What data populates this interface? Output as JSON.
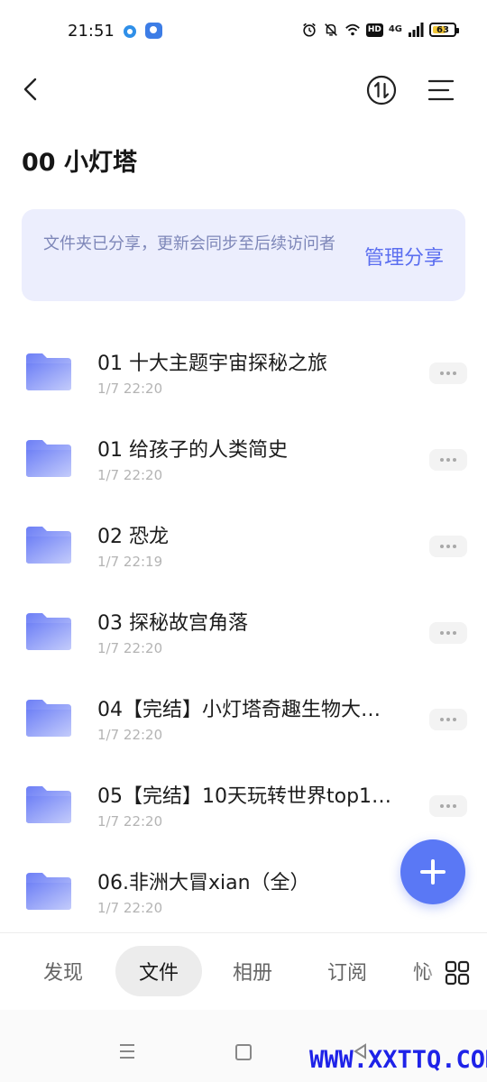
{
  "status_bar": {
    "time": "21:51",
    "network": "4G",
    "hd_label": "HD",
    "battery": "63",
    "battery_level": 0.63,
    "battery_color": "#f2c83a"
  },
  "header": {
    "title": "00 小灯塔"
  },
  "share_banner": {
    "message": "文件夹已分享，更新会同步至后续访问者",
    "manage_label": "管理分享"
  },
  "files": [
    {
      "name": "01 十大主题宇宙探秘之旅",
      "date": "1/7 22:20"
    },
    {
      "name": "01 给孩子的人类简史",
      "date": "1/7 22:20"
    },
    {
      "name": "02 恐龙",
      "date": "1/7 22:19"
    },
    {
      "name": "03 探秘故宫角落",
      "date": "1/7 22:20"
    },
    {
      "name": "04【完结】小灯塔奇趣生物大…",
      "date": "1/7 22:20"
    },
    {
      "name": "05【完结】10天玩转世界top1…",
      "date": "1/7 22:20"
    },
    {
      "name": "06.非洲大冒xian（全）",
      "date": "1/7 22:20"
    }
  ],
  "bottom_nav": {
    "tabs": [
      {
        "label": "发现",
        "active": false
      },
      {
        "label": "文件",
        "active": true
      },
      {
        "label": "相册",
        "active": false
      },
      {
        "label": "订阅",
        "active": false
      },
      {
        "label": "㤈",
        "active": false
      }
    ]
  },
  "watermark": "WWW.XXTTQ.COM",
  "colors": {
    "accent": "#5b6ef0",
    "fab": "#5a78f5",
    "banner_bg": "#eceefd",
    "folder_top": "#6d7ff6",
    "folder_bottom": "#c4ccfb"
  }
}
